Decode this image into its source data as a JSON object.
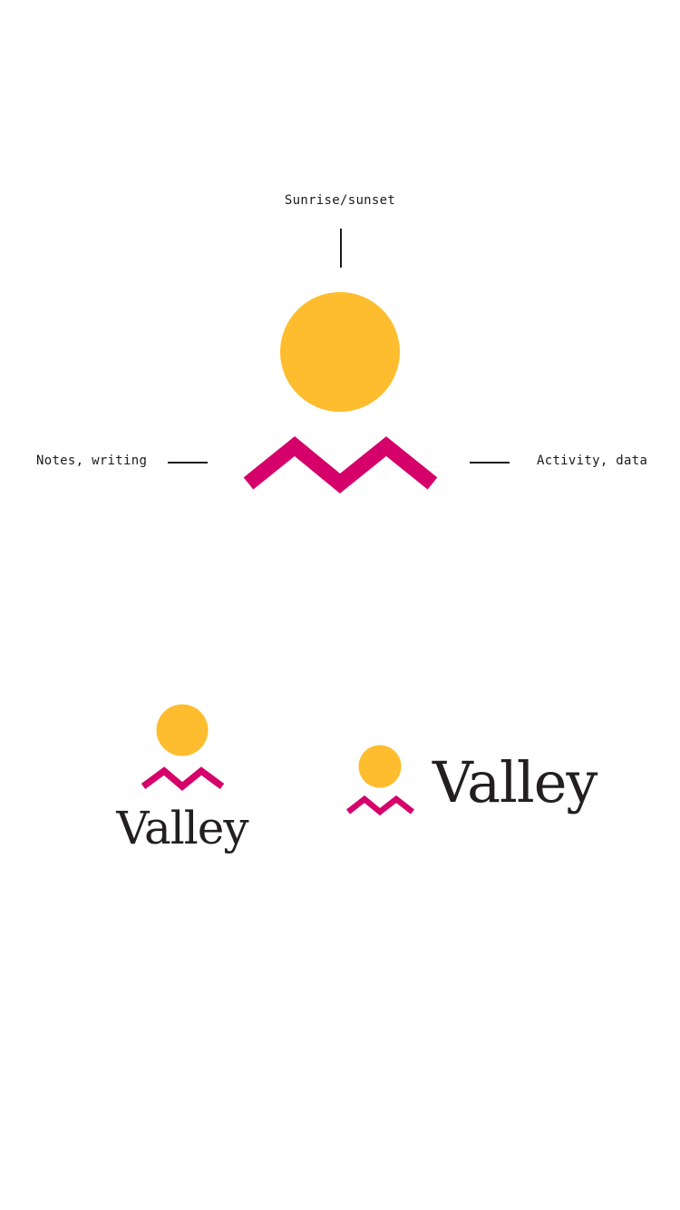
{
  "diagram": {
    "labels": {
      "top": "Sunrise/sunset",
      "left": "Notes, writing",
      "right": "Activity, data"
    }
  },
  "logos": {
    "wordmark": "Valley"
  },
  "colors": {
    "sun": "#FEBD2F",
    "valley": "#D6006B",
    "text": "#1a1a1a",
    "wordmark": "#231f20",
    "background": "#ffffff"
  },
  "icons": [
    "sun-circle-icon",
    "valley-zigzag-icon"
  ]
}
